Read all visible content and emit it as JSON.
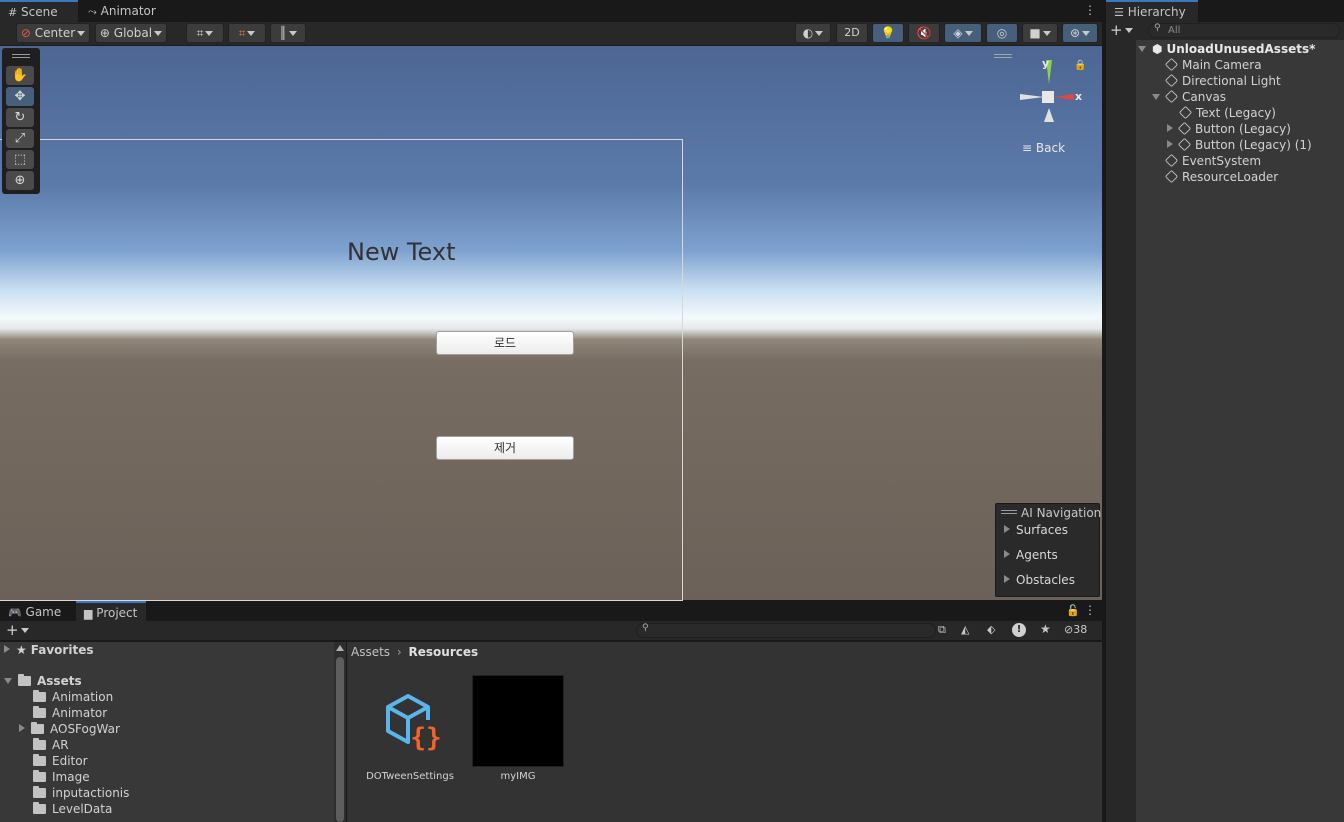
{
  "scene_tabs": {
    "scene": "Scene",
    "animator": "Animator"
  },
  "scene_toolbar": {
    "pivot": "Center",
    "space": "Global",
    "mode_2d": "2D"
  },
  "viewport": {
    "canvas_text": "New Text",
    "button_load": "로드",
    "button_remove": "제거",
    "gizmo": {
      "y": "y",
      "x": "x",
      "view": "Back"
    }
  },
  "ai_navigation": {
    "title": "AI Navigation",
    "items": [
      "Surfaces",
      "Agents",
      "Obstacles"
    ]
  },
  "hierarchy": {
    "tab": "Hierarchy",
    "search_placeholder": "All",
    "scene_name": "UnloadUnusedAssets*",
    "items": [
      "Main Camera",
      "Directional Light",
      "Canvas",
      "Text (Legacy)",
      "Button (Legacy)",
      "Button (Legacy) (1)",
      "EventSystem",
      "ResourceLoader"
    ]
  },
  "bottom_tabs": {
    "game": "Game",
    "project": "Project"
  },
  "project": {
    "hidden_count": "38",
    "favorites": "Favorites",
    "assets": "Assets",
    "folders": [
      "Animation",
      "Animator",
      "AOSFogWar",
      "AR",
      "Editor",
      "Image",
      "inputactionis",
      "LevelData"
    ],
    "breadcrumb": {
      "root": "Assets",
      "current": "Resources"
    },
    "files": [
      "DOTweenSettings",
      "myIMG"
    ]
  },
  "colors": {
    "accent": "#3a79bb",
    "sky_top": "#4a6a9a",
    "ground": "#6e6258",
    "panel": "#282828"
  }
}
